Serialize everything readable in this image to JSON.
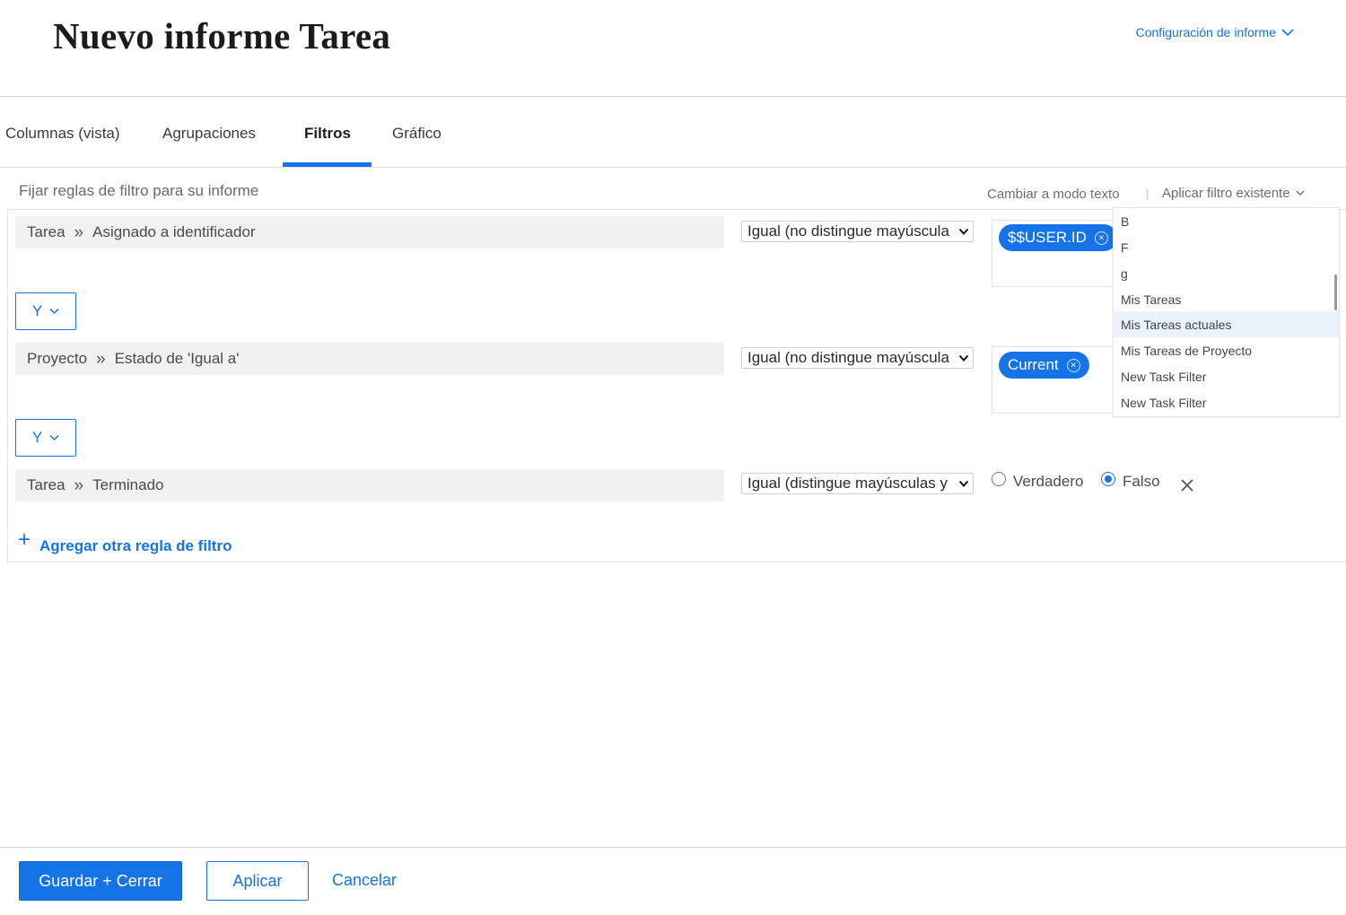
{
  "header": {
    "title": "Nuevo informe Tarea",
    "settings_label": "Configuración de informe",
    "settings_icon": "chevron-down-icon"
  },
  "tabs": [
    {
      "label": "Columnas (vista)",
      "active": false
    },
    {
      "label": "Agrupaciones",
      "active": false
    },
    {
      "label": "Filtros",
      "active": true
    },
    {
      "label": "Gráfico",
      "active": false
    }
  ],
  "filters": {
    "hint": "Fijar reglas de filtro para su informe",
    "text_mode_label": "Cambiar a modo texto",
    "separator": "|",
    "apply_existing_label": "Aplicar filtro existente",
    "rules": [
      {
        "object": "Tarea",
        "field": "Asignado a identificador",
        "operator": "Igual (no distingue mayúscula",
        "value_pill": "$$USER.ID"
      },
      {
        "object": "Proyecto",
        "field": "Estado de 'Igual a'",
        "operator": "Igual (no distingue mayúscula",
        "value_pill": "Current"
      },
      {
        "object": "Tarea",
        "field": "Terminado",
        "operator": "Igual (distingue mayúsculas y",
        "radio_true": "Verdadero",
        "radio_false": "Falso",
        "selected": "Falso"
      }
    ],
    "connectors": [
      "Y",
      "Y"
    ],
    "add_rule_label": "Agregar otra regla de filtro",
    "add_rule_icon": "+"
  },
  "existing_filters_dropdown": {
    "items": [
      "B",
      "F",
      "g",
      "Mis Tareas",
      "Mis Tareas actuales",
      "Mis Tareas de Proyecto",
      "New Task Filter",
      "New Task Filter"
    ],
    "highlighted": "Mis Tareas actuales"
  },
  "footer": {
    "save_close_label": "Guardar + Cerrar",
    "apply_label": "Aplicar",
    "cancel_label": "Cancelar"
  },
  "colors": {
    "accent": "#1473e6",
    "field_bg": "#f1f1f1",
    "highlight_bg": "#e9f1fb"
  }
}
